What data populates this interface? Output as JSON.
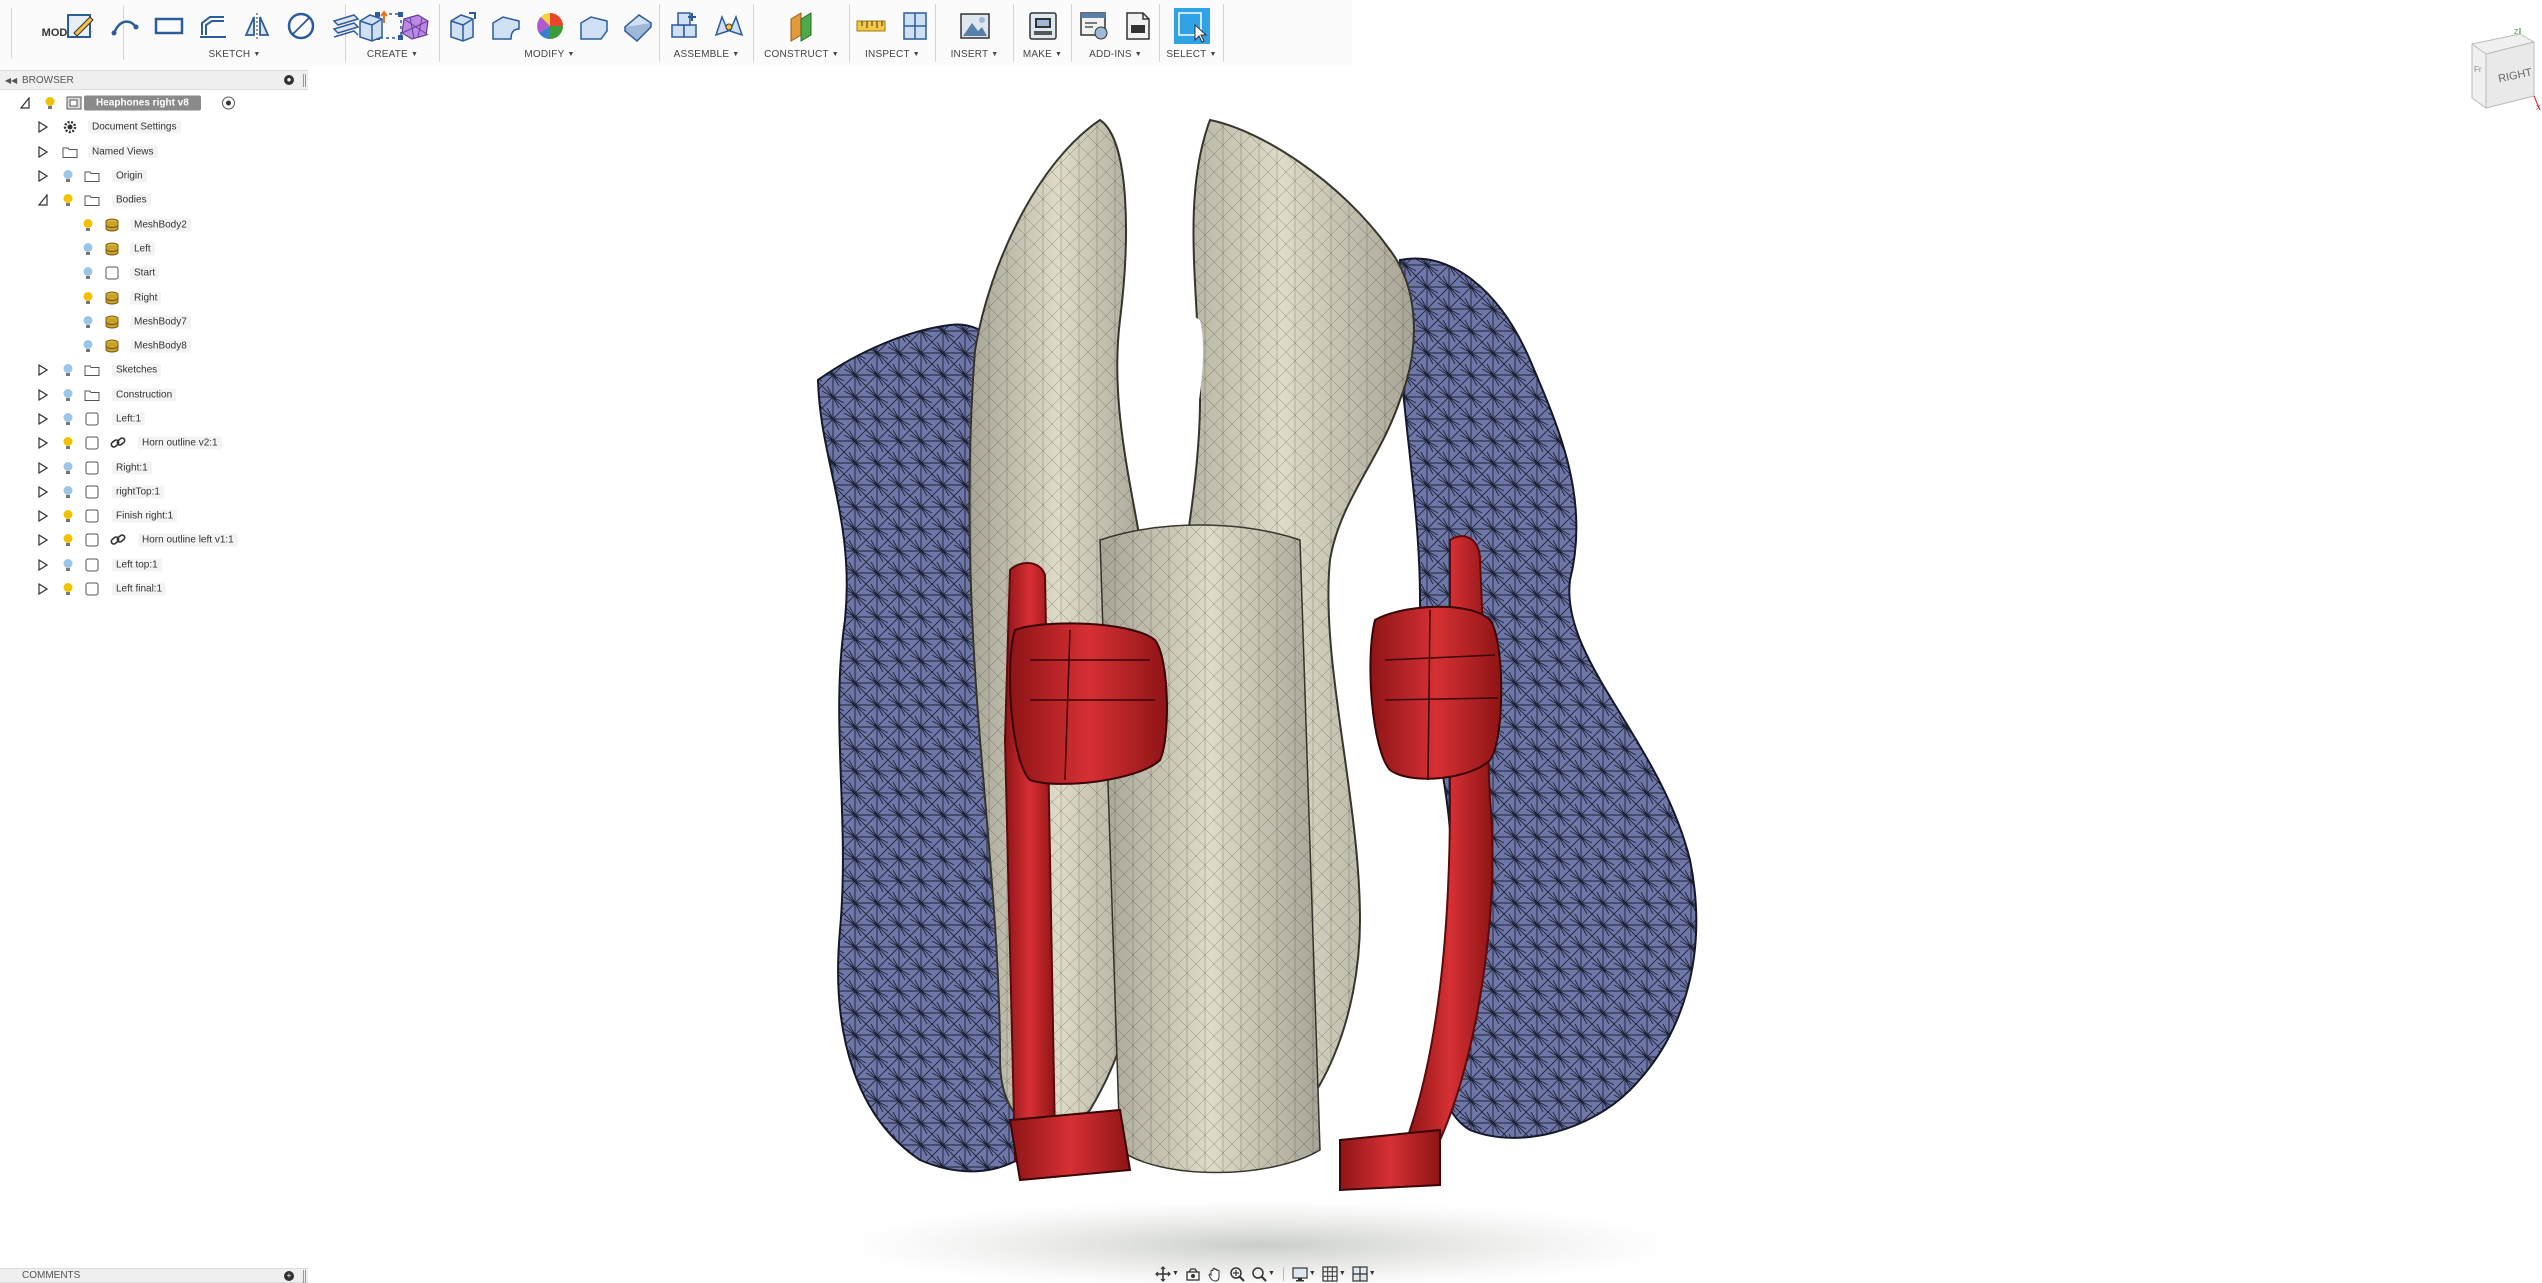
{
  "toolbar": {
    "workspace": "MODEL",
    "groups": [
      {
        "label": "SKETCH"
      },
      {
        "label": "CREATE"
      },
      {
        "label": "MODIFY"
      },
      {
        "label": "ASSEMBLE"
      },
      {
        "label": "CONSTRUCT"
      },
      {
        "label": "INSPECT"
      },
      {
        "label": "INSERT"
      },
      {
        "label": "MAKE"
      },
      {
        "label": "ADD-INS"
      },
      {
        "label": "SELECT"
      }
    ]
  },
  "browser": {
    "title": "BROWSER",
    "items": [
      {
        "label": "Heaphones right v8"
      },
      {
        "label": "Document Settings"
      },
      {
        "label": "Named Views"
      },
      {
        "label": "Origin"
      },
      {
        "label": "Bodies"
      },
      {
        "label": "MeshBody2"
      },
      {
        "label": "Left"
      },
      {
        "label": "Start"
      },
      {
        "label": "Right"
      },
      {
        "label": "MeshBody7"
      },
      {
        "label": "MeshBody8"
      },
      {
        "label": "Sketches"
      },
      {
        "label": "Construction"
      },
      {
        "label": "Left:1"
      },
      {
        "label": "Horn outline v2:1"
      },
      {
        "label": "Right:1"
      },
      {
        "label": "rightTop:1"
      },
      {
        "label": "Finish right:1"
      },
      {
        "label": "Horn outline left v1:1"
      },
      {
        "label": "Left top:1"
      },
      {
        "label": "Left final:1"
      }
    ]
  },
  "comments": {
    "title": "COMMENTS"
  },
  "viewcube": {
    "face": "RIGHT",
    "axis_z": "Z",
    "axis_x": "X",
    "side_face": "Fr"
  },
  "colors": {
    "accent_select": "#2fa3e6",
    "mesh_blue": "#6f77a8",
    "mesh_cream": "#dedbc8",
    "clip_red": "#c8262a",
    "bulb_on": "#f2c200",
    "bulb_off": "#9cc6e8"
  }
}
